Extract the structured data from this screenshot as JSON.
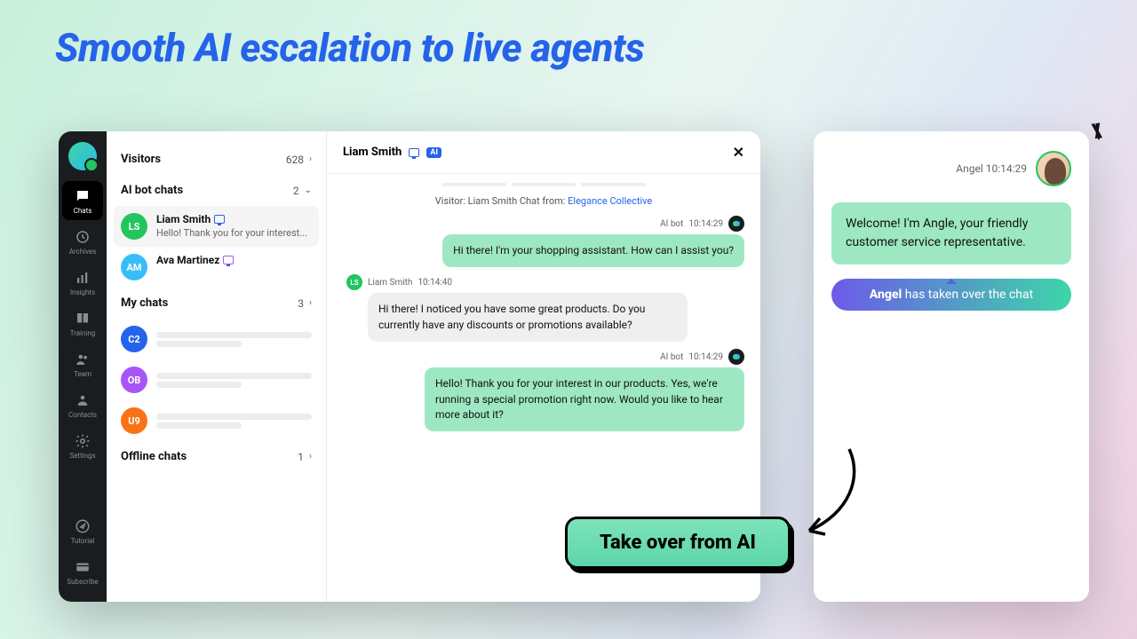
{
  "headline": "Smooth AI escalation to live agents",
  "rail": {
    "items": [
      {
        "label": "Chats",
        "icon": "chat"
      },
      {
        "label": "Archives",
        "icon": "archive"
      },
      {
        "label": "Insights",
        "icon": "bars"
      },
      {
        "label": "Training",
        "icon": "book"
      },
      {
        "label": "Team",
        "icon": "team"
      },
      {
        "label": "Contacts",
        "icon": "contact"
      },
      {
        "label": "Settings",
        "icon": "gear"
      }
    ],
    "bottom": [
      {
        "label": "Tutorial",
        "icon": "compass"
      },
      {
        "label": "Subscribe",
        "icon": "card"
      }
    ]
  },
  "list": {
    "visitors": {
      "label": "Visitors",
      "count": "628"
    },
    "aibot": {
      "label": "AI bot chats",
      "count": "2"
    },
    "aibot_items": [
      {
        "initials": "LS",
        "color": "#22c55e",
        "name": "Liam Smith",
        "preview": "Hello! Thank you for your interest..."
      },
      {
        "initials": "AM",
        "color": "#38bdf8",
        "name": "Ava Martinez",
        "preview": ""
      }
    ],
    "mychats": {
      "label": "My chats",
      "count": "3"
    },
    "mychats_items": [
      {
        "initials": "C2",
        "color": "#2563eb"
      },
      {
        "initials": "OB",
        "color": "#a855f7"
      },
      {
        "initials": "U9",
        "color": "#f97316"
      }
    ],
    "offline": {
      "label": "Offline chats",
      "count": "1"
    }
  },
  "conv": {
    "title": "Liam Smith",
    "ai_badge": "AI",
    "source_prefix": "Visitor: Liam Smith Chat from: ",
    "source_link": "Elegance Collective",
    "msgs": [
      {
        "side": "right",
        "who": "AI bot",
        "time": "10:14:29",
        "text": "Hi there! I'm your shopping assistant. How can I assist you?"
      },
      {
        "side": "left",
        "who": "Liam Smith",
        "initials": "LS",
        "time": "10:14:40",
        "text": "Hi there! I noticed you have some great products. Do you currently have any discounts or promotions available?"
      },
      {
        "side": "right",
        "who": "AI bot",
        "time": "10:14:29",
        "text": "Hello! Thank you for your interest in our products. Yes, we're running a special promotion right now. Would you like to hear more about it?"
      }
    ]
  },
  "angel": {
    "name": "Angel",
    "time": "10:14:29",
    "welcome": "Welcome! I'm Angle, your friendly customer service representative.",
    "pill_name": "Angel",
    "pill_rest": " has taken over the chat"
  },
  "callout": "Take over from AI"
}
